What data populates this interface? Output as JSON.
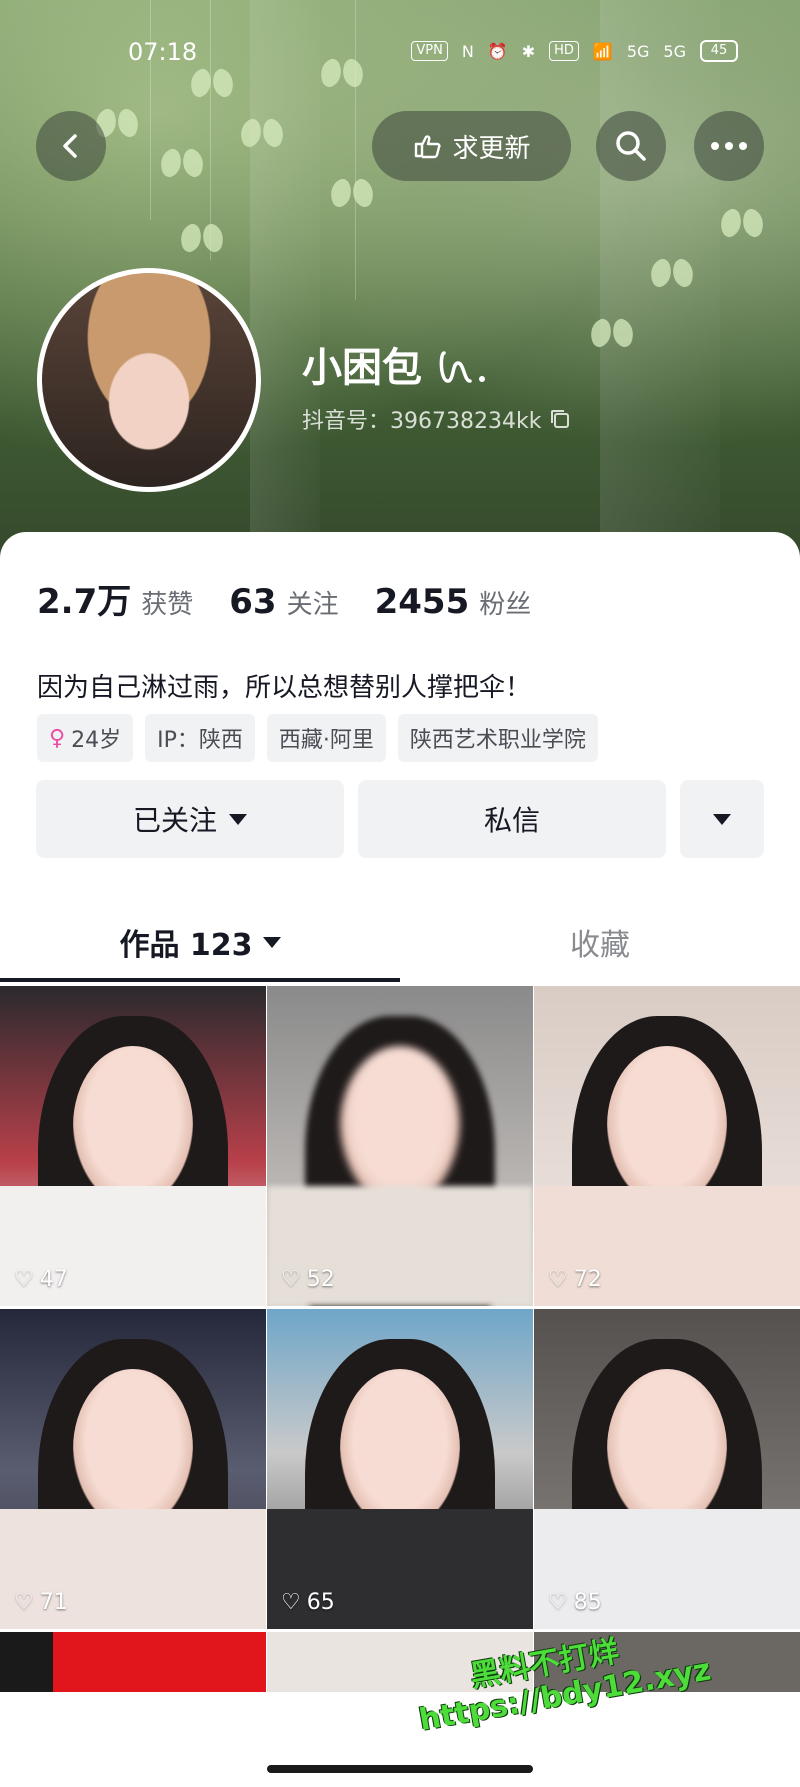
{
  "status_bar": {
    "time": "07:18",
    "indicators": [
      "VPN",
      "N",
      "alarm",
      "bluetooth",
      "HD",
      "wifi",
      "5G",
      "5G"
    ],
    "battery": "45"
  },
  "nav": {
    "back_icon": "chevron-left-icon",
    "request_update_label": "求更新",
    "search_icon": "search-icon",
    "more_icon": "more-icon"
  },
  "profile": {
    "name": "小困包",
    "douyin_id_label": "抖音号：396738234kk",
    "stats": [
      {
        "value": "2.7万",
        "label": "获赞"
      },
      {
        "value": "63",
        "label": "关注"
      },
      {
        "value": "2455",
        "label": "粉丝"
      }
    ],
    "bio": "因为自己淋过雨，所以总想替别人撑把伞！",
    "tags": [
      "24岁",
      "IP：陕西",
      "西藏·阿里",
      "陕西艺术职业学院"
    ]
  },
  "actions": {
    "followed_label": "已关注",
    "message_label": "私信"
  },
  "tabs": {
    "works_label": "作品 123",
    "favorites_label": "收藏"
  },
  "videos": [
    {
      "likes": "47"
    },
    {
      "likes": "52"
    },
    {
      "likes": "72"
    },
    {
      "likes": "71"
    },
    {
      "likes": "65"
    },
    {
      "likes": "85"
    }
  ],
  "watermark": {
    "line1": "黑料不打烊",
    "line2": "https://bdy12.xyz"
  },
  "colors": {
    "banner": "#5b7a48",
    "accent_female": "#ea4ea5",
    "watermark": "#4ddc3a"
  }
}
